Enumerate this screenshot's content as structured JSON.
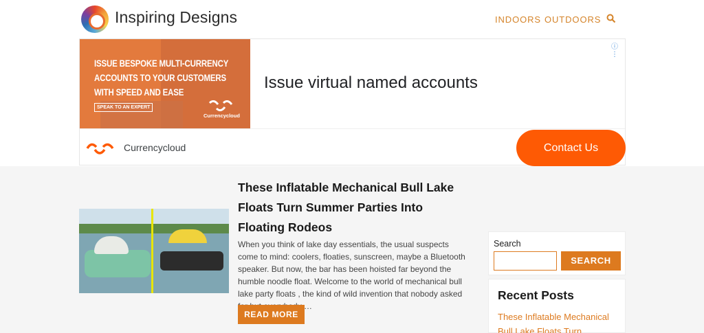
{
  "header": {
    "site_title": "Inspiring Designs",
    "logo_icon": "swirl-logo-icon",
    "nav": [
      {
        "label": "INDOORS"
      },
      {
        "label": "OUTDOORS"
      }
    ],
    "search_icon": "search-icon",
    "accent_color": "#d5842a"
  },
  "ad": {
    "image_text": "ISSUE BESPOKE MULTI-CURRENCY ACCOUNTS TO YOUR CUSTOMERS WITH SPEED AND EASE",
    "image_cta": "SPEAK TO AN EXPERT",
    "image_brand": "Currencycloud",
    "headline": "Issue virtual named accounts",
    "advertiser": "Currencycloud",
    "cta": "Contact Us",
    "cta_color": "#fe5a04",
    "info_icon": "ⓘ ⋮"
  },
  "post": {
    "title": "These Inflatable Mechanical Bull Lake Floats Turn Summer Parties Into Floating Rodeos",
    "excerpt": "When you think of lake day essentials, the usual suspects come to mind: coolers, floaties, sunscreen, maybe a Bluetooth speaker. But now, the bar has been hoisted far beyond the humble noodle float. Welcome to the world of mechanical bull lake party floats , the kind of wild invention that nobody asked for but everybody …",
    "read_more": "READ MORE"
  },
  "sidebar": {
    "search_label": "Search",
    "search_value": "",
    "search_button": "SEARCH",
    "recent_title": "Recent Posts",
    "recent_posts": [
      {
        "label": "These Inflatable Mechanical Bull Lake Floats Turn"
      }
    ]
  }
}
